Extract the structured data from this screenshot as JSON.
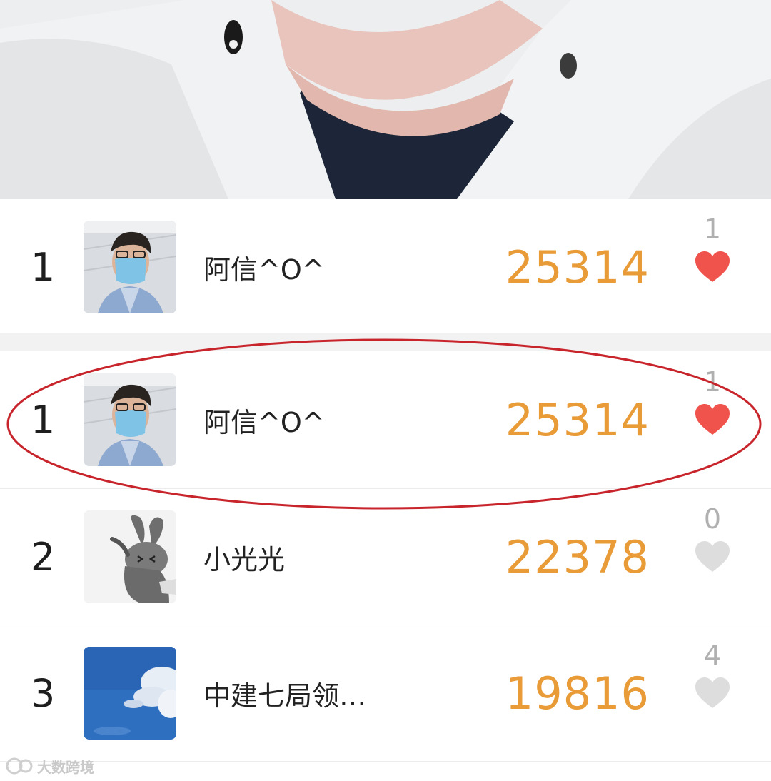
{
  "cover": {
    "image": "cover-photo"
  },
  "my_entry": {
    "rank": "1",
    "avatar": "avatar-masked-man",
    "nickname": "阿信^O^",
    "steps": "25314",
    "likes": "1",
    "liked": true
  },
  "leaderboard": [
    {
      "rank": "1",
      "avatar": "avatar-masked-man",
      "nickname": "阿信^O^",
      "steps": "25314",
      "likes": "1",
      "liked": true
    },
    {
      "rank": "2",
      "avatar": "avatar-cartoon-rabbit",
      "nickname": "小光光",
      "steps": "22378",
      "likes": "0",
      "liked": false
    },
    {
      "rank": "3",
      "avatar": "avatar-blue-sky",
      "nickname": "中建七局领…",
      "steps": "19816",
      "likes": "4",
      "liked": false
    }
  ],
  "colors": {
    "steps": "#e89b37",
    "heart_liked": "#f0534c",
    "heart_unliked": "#dddddd",
    "highlight_oval": "#c8242b"
  },
  "watermark": {
    "text": "大数跨境",
    "icon": "logo-icon"
  }
}
